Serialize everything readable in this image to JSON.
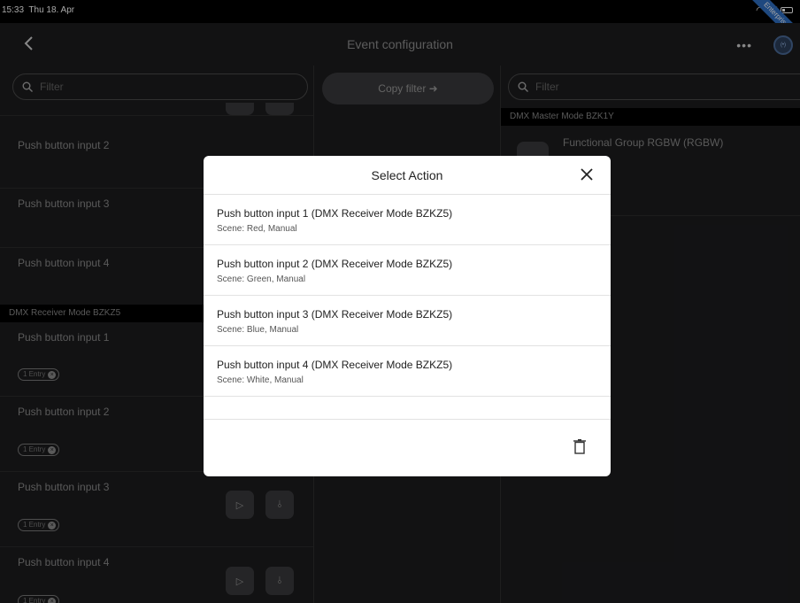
{
  "status": {
    "time": "15:33",
    "date": "Thu 18. Apr",
    "battery": "45",
    "ribbon": "Enterprise"
  },
  "nav": {
    "title": "Event configuration",
    "more": "•••",
    "radio": "(•)"
  },
  "left": {
    "filter_placeholder": "Filter",
    "rows_top": [
      {
        "label": "Push button input 2"
      },
      {
        "label": "Push button input 3"
      },
      {
        "label": "Push button input 4"
      }
    ],
    "section": "DMX Receiver Mode BZKZ5",
    "rows_bottom": [
      {
        "label": "Push button input 1",
        "chip": "1 Entry"
      },
      {
        "label": "Push button input 2",
        "chip": "1 Entry"
      },
      {
        "label": "Push button input 3",
        "chip": "1 Entry"
      },
      {
        "label": "Push button input 4",
        "chip": "1 Entry"
      }
    ]
  },
  "middle": {
    "copy_filter": "Copy filter ➜"
  },
  "right": {
    "filter_placeholder": "Filter",
    "section": "DMX Master Mode BZK1Y",
    "group_title": "Functional Group RGBW (RGBW)"
  },
  "modal": {
    "title": "Select Action",
    "actions": [
      {
        "title": "Push button input 1 (DMX Receiver Mode BZKZ5)",
        "subtitle": "Scene: Red, Manual"
      },
      {
        "title": "Push button input 2 (DMX Receiver Mode BZKZ5)",
        "subtitle": "Scene: Green, Manual"
      },
      {
        "title": "Push button input 3 (DMX Receiver Mode BZKZ5)",
        "subtitle": "Scene: Blue, Manual"
      },
      {
        "title": "Push button input 4 (DMX Receiver Mode BZKZ5)",
        "subtitle": "Scene: White, Manual"
      }
    ]
  }
}
